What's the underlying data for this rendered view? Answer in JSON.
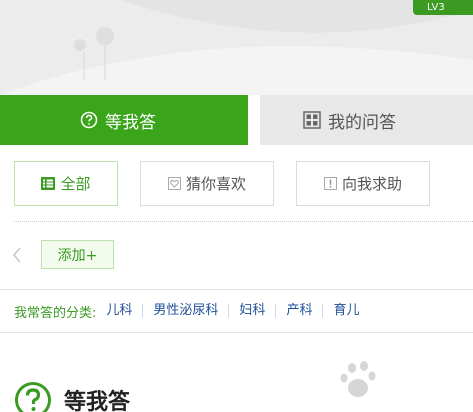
{
  "header": {
    "level_badge": "LV3"
  },
  "tabs": [
    {
      "label": "等我答",
      "icon": "question-circle-icon",
      "active": true
    },
    {
      "label": "我的问答",
      "icon": "grid-icon",
      "active": false
    }
  ],
  "filters": [
    {
      "label": "全部",
      "icon": "list-icon",
      "active": true
    },
    {
      "label": "猜你喜欢",
      "icon": "heart-icon",
      "active": false
    },
    {
      "label": "向我求助",
      "icon": "exclamation-icon",
      "active": false
    }
  ],
  "add_button": "添加+",
  "categories": {
    "label": "我常答的分类:",
    "items": [
      "儿科",
      "男性泌尿科",
      "妇科",
      "产科",
      "育儿"
    ]
  },
  "section": {
    "title": "等我答"
  },
  "colors": {
    "accent": "#3aa51b",
    "link": "#1e4f9a",
    "inactive_tab": "#e8e8e8"
  }
}
